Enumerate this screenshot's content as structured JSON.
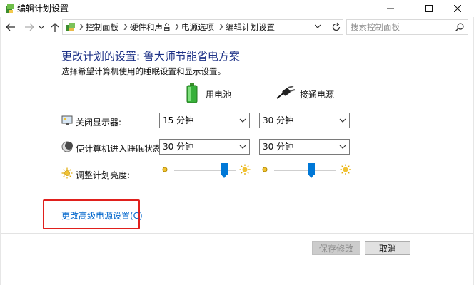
{
  "window": {
    "title": "编辑计划设置",
    "controls": {
      "minimize_icon": "minimize-icon",
      "maximize_icon": "maximize-icon",
      "close_icon": "close-icon"
    }
  },
  "nav": {
    "back_icon": "back-arrow-icon",
    "forward_icon": "forward-arrow-icon",
    "recent_icon": "chevron-down-icon",
    "up_icon": "up-arrow-icon",
    "address_icon": "control-panel-icon",
    "breadcrumbs": [
      "控制面板",
      "硬件和声音",
      "电源选项",
      "编辑计划设置"
    ],
    "refresh_icon": "refresh-icon",
    "search_placeholder": "搜索控制面板"
  },
  "main": {
    "heading": "更改计划的设置: 鲁大师节能省电方案",
    "subheading": "选择希望计算机使用的睡眠设置和显示设置。",
    "columns": [
      {
        "label": "用电池",
        "icon": "battery-icon"
      },
      {
        "label": "接通电源",
        "icon": "power-plug-icon"
      }
    ],
    "rows": [
      {
        "label": "关闭显示器:",
        "icon": "display-icon",
        "battery_value": "15 分钟",
        "plugged_value": "30 分钟"
      },
      {
        "label": "使计算机进入睡眠状态:",
        "icon": "sleep-moon-icon",
        "battery_value": "30 分钟",
        "plugged_value": "30 分钟"
      }
    ],
    "brightness": {
      "label": "调整计划亮度:",
      "icon": "brightness-sun-icon",
      "battery_level": 0.86,
      "plugged_level": 0.62
    },
    "advanced_link": "更改高级电源设置(C)"
  },
  "footer": {
    "save_label": "保存修改",
    "cancel_label": "取消"
  },
  "colors": {
    "heading": "#1e3287",
    "link": "#0066cc",
    "highlight": "#e0201d",
    "slider_thumb": "#0078d7"
  }
}
